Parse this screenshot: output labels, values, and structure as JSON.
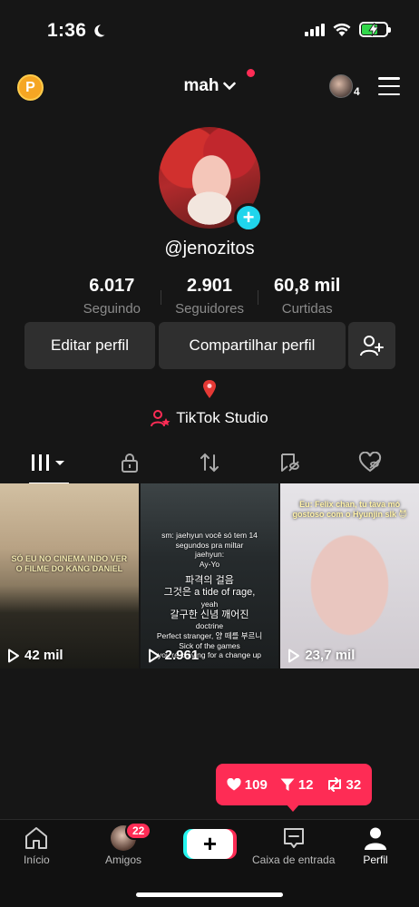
{
  "status_bar": {
    "time": "1:36",
    "icons": [
      "moon-icon",
      "signal-icon",
      "wifi-icon",
      "battery-charging-icon"
    ],
    "battery_color": "#32d74b"
  },
  "header": {
    "coin_label": "P",
    "username": "mah",
    "account_count": "4"
  },
  "profile": {
    "handle": "@jenozitos",
    "stats": [
      {
        "value": "6.017",
        "label": "Seguindo"
      },
      {
        "value": "2.901",
        "label": "Seguidores"
      },
      {
        "value": "60,8 mil",
        "label": "Curtidas"
      }
    ],
    "edit_label": "Editar perfil",
    "share_label": "Compartilhar perfil",
    "studio_label": "TikTok Studio"
  },
  "tabs": [
    "videos-grid-icon",
    "lock-icon",
    "repost-icon",
    "saved-icon",
    "liked-icon"
  ],
  "videos": [
    {
      "views": "42 mil",
      "caption": "SÓ EU NO CINEMA INDO VER O FILME DO KANG DANIEL"
    },
    {
      "views": "2.961",
      "lines": [
        "sm: jaehyun você só tem 14 segundos pra miltar",
        "jaehyun:",
        "Ay-Yo",
        "파격의 걸음",
        "그것은 a tide of rage,",
        "yeah",
        "갈구한 신념 깨어진",
        "doctrine",
        "Perfect stranger, 양 떼를 부르니",
        "Sick of the games",
        "you're craving for a change up"
      ]
    },
    {
      "views": "23,7 mil",
      "caption": "Eu: Felix chan, tu tava mó gostoso com o Hyunjin slk 😈"
    }
  ],
  "notification": {
    "likes": "109",
    "shares": "12",
    "reposts": "32",
    "color": "#fe2c55"
  },
  "bottom_nav": {
    "home": "Início",
    "friends": "Amigos",
    "friends_badge": "22",
    "create": "+",
    "inbox": "Caixa de entrada",
    "profile": "Perfil"
  },
  "colors": {
    "background": "#161616",
    "accent_cyan": "#20d5ec",
    "accent_red": "#fe2c55",
    "button_bg": "#2f2f2f"
  }
}
